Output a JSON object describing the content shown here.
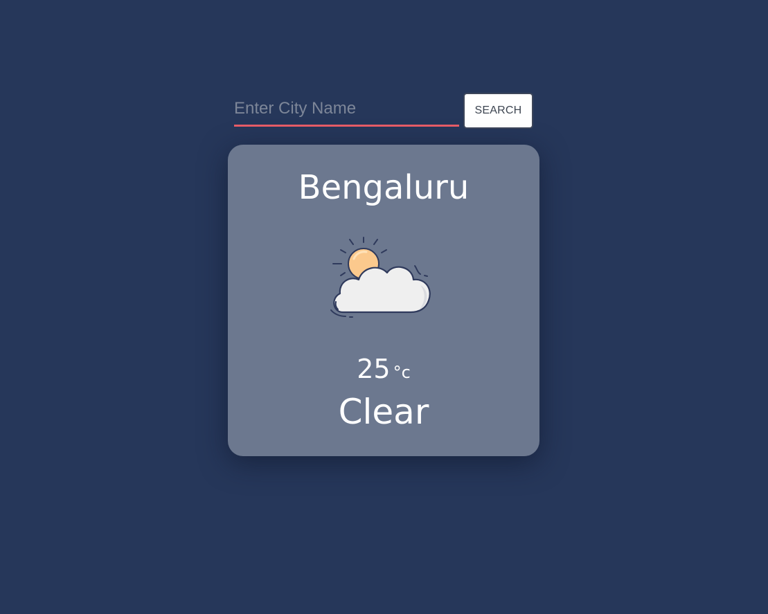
{
  "search": {
    "placeholder": "Enter City Name",
    "value": "",
    "button_label": "SEARCH"
  },
  "weather": {
    "city": "Bengaluru",
    "icon": "sun-behind-cloud-icon",
    "temperature": "25",
    "unit": "°c",
    "condition": "Clear"
  },
  "colors": {
    "background": "#26375a",
    "card": "#6c788f",
    "input_underline": "#e85d68",
    "text": "#ffffff"
  }
}
